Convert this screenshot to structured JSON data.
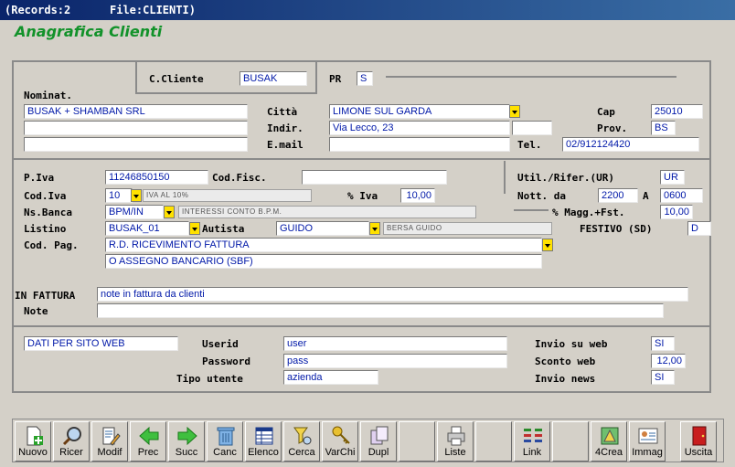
{
  "window": {
    "records": "(Records:2",
    "file": "File:CLIENTI)"
  },
  "app_title": "Anagrafica Clienti",
  "labels": {
    "c_cliente": "C.Cliente",
    "pr": "PR",
    "nominat": "Nominat.",
    "citta": "Città",
    "indir": "Indir.",
    "email": "E.mail",
    "cap": "Cap",
    "prov": "Prov.",
    "tel": "Tel.",
    "p_iva": "P.Iva",
    "cod_fisc": "Cod.Fisc.",
    "util_rifer": "Util./Rifer.(UR)",
    "cod_iva": "Cod.Iva",
    "perc_iva": "% Iva",
    "nott_da": "Nott. da",
    "nott_a": "A",
    "ns_banca": "Ns.Banca",
    "perc_magg": "% Magg.+Fst.",
    "listino": "Listino",
    "autista": "Autista",
    "festivo": "FESTIVO (SD)",
    "cod_pag": "Cod. Pag.",
    "in_fattura": "IN FATTURA",
    "note": "Note",
    "userid": "Userid",
    "password": "Password",
    "tipo_utente": "Tipo utente",
    "invio_web": "Invio su web",
    "sconto_web": "Sconto web",
    "invio_news": "Invio news"
  },
  "fields": {
    "c_cliente": "BUSAK",
    "pr": "S",
    "nominat1": "BUSAK + SHAMBAN SRL",
    "nominat2": "",
    "nominat3": "",
    "citta": "LIMONE SUL GARDA",
    "indir": "Via Lecco, 23",
    "indir2": "",
    "email": "",
    "cap": "25010",
    "prov": "BS",
    "tel": "02/912124420",
    "p_iva": "11246850150",
    "cod_fisc": "",
    "util_rifer": "UR",
    "cod_iva": "10",
    "cod_iva_desc": "IVA AL 10%",
    "perc_iva": "10,00",
    "nott_da": "2200",
    "nott_a": "0600",
    "ns_banca": "BPM/IN",
    "ns_banca_desc": "INTERESSI CONTO B.P.M.",
    "perc_magg": "10,00",
    "listino": "BUSAK_01",
    "autista": "GUIDO",
    "autista_desc": "BERSA GUIDO",
    "festivo": "D",
    "cod_pag1": "R.D. RICEVIMENTO FATTURA",
    "cod_pag2": "O ASSEGNO BANCARIO (SBF)",
    "in_fattura": "note in fattura da clienti",
    "note": "",
    "dati_web": "DATI PER SITO WEB",
    "userid": "user",
    "password": "pass",
    "tipo_utente": "azienda",
    "invio_web": "SI",
    "sconto_web": "12,00",
    "invio_news": "SI"
  },
  "toolbar": [
    {
      "label": "Nuovo",
      "icon": "new-doc-icon"
    },
    {
      "label": "Ricer",
      "icon": "magnifier-icon"
    },
    {
      "label": "Modif",
      "icon": "edit-doc-icon"
    },
    {
      "label": "Prec",
      "icon": "arrow-left-icon"
    },
    {
      "label": "Succ",
      "icon": "arrow-right-icon"
    },
    {
      "label": "Canc",
      "icon": "trash-icon"
    },
    {
      "label": "Elenco",
      "icon": "list-icon"
    },
    {
      "label": "Cerca",
      "icon": "search-filter-icon"
    },
    {
      "label": "VarChi",
      "icon": "keys-icon"
    },
    {
      "label": "Dupl",
      "icon": "duplicate-icon"
    },
    {
      "label": "",
      "icon": ""
    },
    {
      "label": "Liste",
      "icon": "printer-icon"
    },
    {
      "label": "",
      "icon": ""
    },
    {
      "label": "Link",
      "icon": "link-icon"
    },
    {
      "label": "",
      "icon": ""
    },
    {
      "label": "4Crea",
      "icon": "create-icon"
    },
    {
      "label": "Immag",
      "icon": "image-card-icon"
    },
    {
      "label": "Uscita",
      "icon": "exit-door-icon"
    }
  ],
  "colors": {
    "title_bar": "#0a246a",
    "app_title": "#12922a",
    "field_text": "#0018a8",
    "dropdown": "#ffe100"
  }
}
